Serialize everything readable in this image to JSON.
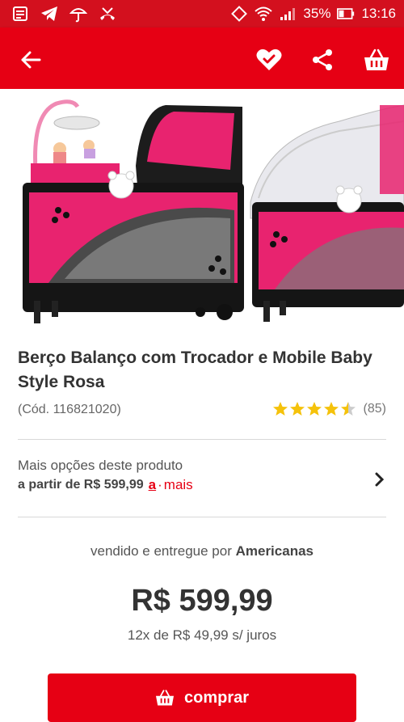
{
  "status_bar": {
    "battery": "35%",
    "time": "13:16"
  },
  "app_bar": {
    "icons": [
      "back-arrow-icon",
      "heart-check-icon",
      "share-icon",
      "basket-icon"
    ]
  },
  "product": {
    "title": "Berço Balanço com Trocador e Mobile Baby Style Rosa",
    "code": "(Cód. 116821020)",
    "rating_value": 4.5,
    "rating_count": "(85)"
  },
  "options": {
    "line1": "Mais opções deste produto",
    "from_price": "a partir de R$ 599,99",
    "brand_a": "a",
    "brand_dot": "·",
    "brand_text": "mais"
  },
  "seller": {
    "prefix": "vendido e entregue por",
    "name": "Americanas"
  },
  "price": {
    "value": "R$ 599,99",
    "installments": "12x de R$ 49,99 s/ juros"
  },
  "buy_button": {
    "label": "comprar"
  },
  "colors": {
    "brand_red": "#e60014",
    "status_red": "#d3101e",
    "star_yellow": "#f5c20b"
  }
}
